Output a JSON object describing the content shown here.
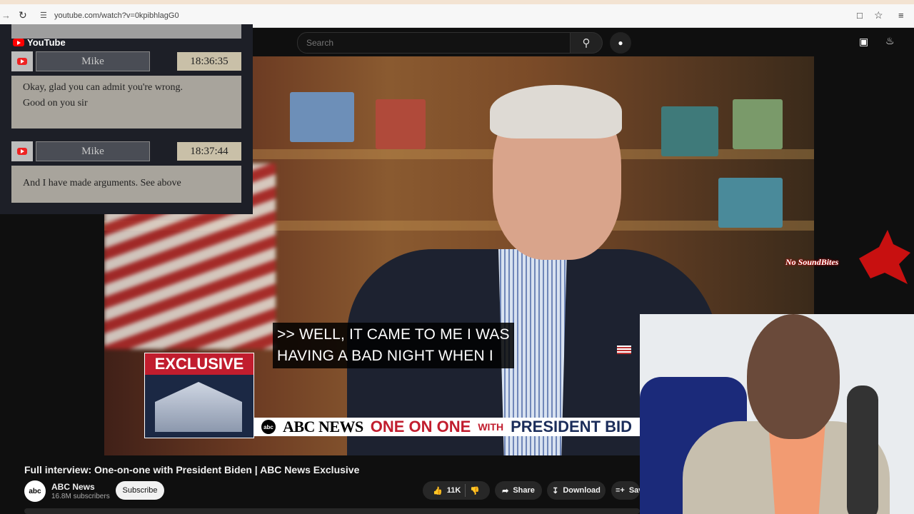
{
  "browser": {
    "url": "youtube.com/watch?v=0kpibhlagG0",
    "icons": [
      "back-icon",
      "reload-icon",
      "site-info-icon",
      "install-icon",
      "star-icon",
      "reading-list-icon"
    ]
  },
  "youtube": {
    "logo_text": "YouTube",
    "search_placeholder": "Search",
    "icons": [
      "search-icon",
      "mic-icon",
      "create-icon",
      "bell-icon"
    ]
  },
  "chat": {
    "messages": [
      {
        "author": "Mike",
        "time": "18:36:35",
        "text_line1": "Okay, glad you can admit you're wrong.",
        "text_line2": "Good on you sir"
      },
      {
        "author": "Mike",
        "time": "18:37:44",
        "text_line1": "And I have made arguments. See above",
        "text_line2": ""
      }
    ]
  },
  "video": {
    "caption_line1": ">> WELL, IT CAME TO ME I WAS",
    "caption_line2": "HAVING A BAD NIGHT WHEN I",
    "exclusive_label": "EXCLUSIVE",
    "network": "ABC NEWS",
    "one_on_one": "ONE ON ONE",
    "with": "WITH",
    "president": "PRESIDENT BID"
  },
  "watermark_text": "No SoundBites",
  "meta": {
    "title": "Full interview: One-on-one with President Biden | ABC News Exclusive",
    "channel": "ABC News",
    "subscribers": "16.8M subscribers",
    "subscribe_label": "Subscribe",
    "likes": "11K",
    "share_label": "Share",
    "download_label": "Download",
    "save_label": "Sav"
  },
  "colors": {
    "accent_red": "#c11d2e",
    "navy": "#1b2d5a",
    "yt_dark": "#0f0f0f"
  }
}
